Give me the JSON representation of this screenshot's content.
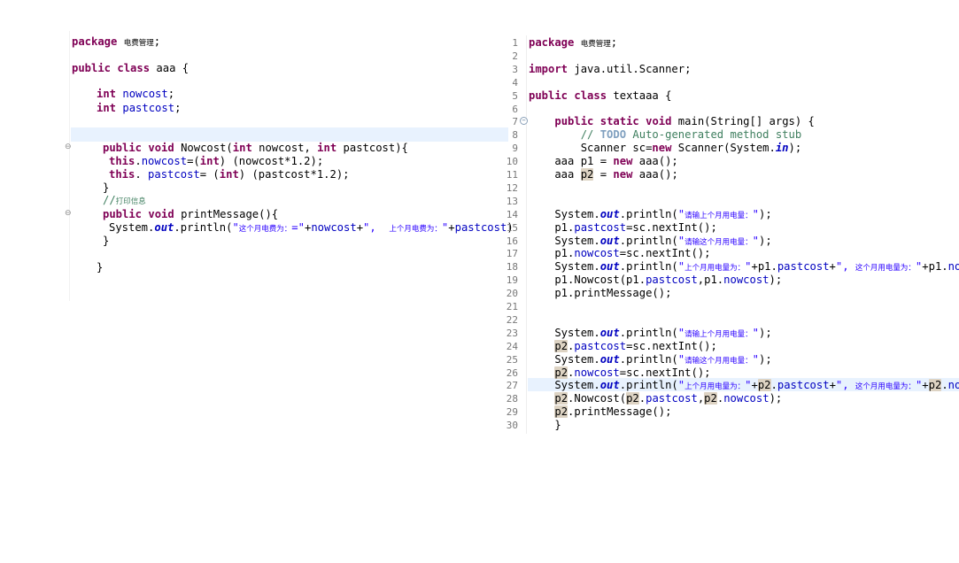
{
  "left_editor": {
    "lines": [
      {
        "parts": [
          {
            "t": "package",
            "c": "kw"
          },
          {
            "t": " "
          },
          {
            "t": "电费管理",
            "c": "cjk"
          },
          {
            "t": ";"
          }
        ]
      },
      {
        "parts": [
          {
            "t": "public",
            "c": "kw"
          },
          {
            "t": " "
          },
          {
            "t": "class",
            "c": "kw"
          },
          {
            "t": " aaa {"
          }
        ]
      },
      {
        "parts": [
          {
            "t": "int",
            "c": "kw"
          },
          {
            "t": " "
          },
          {
            "t": "nowcost",
            "c": "fld"
          },
          {
            "t": ";"
          }
        ]
      },
      {
        "parts": [
          {
            "t": "int",
            "c": "kw"
          },
          {
            "t": " "
          },
          {
            "t": "pastcost",
            "c": "fld"
          },
          {
            "t": ";"
          }
        ]
      },
      {
        "parts": [
          {
            "t": "public",
            "c": "kw"
          },
          {
            "t": " "
          },
          {
            "t": "void",
            "c": "kw"
          },
          {
            "t": " Nowcost("
          },
          {
            "t": "int",
            "c": "kw"
          },
          {
            "t": " nowcost, "
          },
          {
            "t": "int",
            "c": "kw"
          },
          {
            "t": " pastcost){"
          }
        ]
      },
      {
        "parts": [
          {
            "t": "this",
            "c": "kw"
          },
          {
            "t": "."
          },
          {
            "t": "nowcost",
            "c": "fld"
          },
          {
            "t": "=("
          },
          {
            "t": "int",
            "c": "kw"
          },
          {
            "t": ") (nowcost*1.2);"
          }
        ]
      },
      {
        "parts": [
          {
            "t": "this",
            "c": "kw"
          },
          {
            "t": ". "
          },
          {
            "t": "pastcost",
            "c": "fld"
          },
          {
            "t": "= ("
          },
          {
            "t": "int",
            "c": "kw"
          },
          {
            "t": ") (pastcost*1.2);"
          }
        ]
      },
      {
        "parts": [
          {
            "t": "}"
          }
        ]
      },
      {
        "parts": [
          {
            "t": "//",
            "c": "cmt"
          },
          {
            "t": "打印信息",
            "c": "cmt cjk"
          }
        ]
      },
      {
        "parts": [
          {
            "t": "public",
            "c": "kw"
          },
          {
            "t": " "
          },
          {
            "t": "void",
            "c": "kw"
          },
          {
            "t": " printMessage(){"
          }
        ]
      },
      {
        "parts": [
          {
            "t": "System."
          },
          {
            "t": "out",
            "c": "sfld"
          },
          {
            "t": ".println("
          },
          {
            "t": "\"",
            "c": "str"
          },
          {
            "t": "这个月电费为：",
            "c": "str cjk"
          },
          {
            "t": "=\"",
            "c": "str"
          },
          {
            "t": "+"
          },
          {
            "t": "nowcost",
            "c": "fld"
          },
          {
            "t": "+"
          },
          {
            "t": "\",  ",
            "c": "str"
          },
          {
            "t": "上个月电费为：",
            "c": "str cjk"
          },
          {
            "t": "\"",
            "c": "str"
          },
          {
            "t": "+"
          },
          {
            "t": "pastcost",
            "c": "fld"
          },
          {
            "t": ")"
          }
        ]
      },
      {
        "parts": [
          {
            "t": "}"
          }
        ]
      },
      {
        "parts": [
          {
            "t": "}"
          }
        ]
      }
    ]
  },
  "right_editor": {
    "line_numbers": [
      "1",
      "2",
      "3",
      "4",
      "5",
      "6",
      "7",
      "8",
      "9",
      "10",
      "11",
      "12",
      "13",
      "14",
      "15",
      "16",
      "17",
      "18",
      "19",
      "20",
      "21",
      "22",
      "23",
      "24",
      "25",
      "26",
      "27",
      "28",
      "29",
      "30"
    ],
    "lines": [
      {
        "parts": [
          {
            "t": "package",
            "c": "kw"
          },
          {
            "t": " "
          },
          {
            "t": "电费管理",
            "c": "cjk"
          },
          {
            "t": ";"
          }
        ]
      },
      {
        "parts": []
      },
      {
        "parts": [
          {
            "t": "import",
            "c": "kw"
          },
          {
            "t": " java.util.Scanner;"
          }
        ]
      },
      {
        "parts": []
      },
      {
        "parts": [
          {
            "t": "public",
            "c": "kw"
          },
          {
            "t": " "
          },
          {
            "t": "class",
            "c": "kw"
          },
          {
            "t": " textaaa {"
          }
        ]
      },
      {
        "parts": []
      },
      {
        "parts": [
          {
            "t": "    "
          },
          {
            "t": "public",
            "c": "kw"
          },
          {
            "t": " "
          },
          {
            "t": "static",
            "c": "kw"
          },
          {
            "t": " "
          },
          {
            "t": "void",
            "c": "kw"
          },
          {
            "t": " main(String[] args) {"
          }
        ]
      },
      {
        "parts": [
          {
            "t": "        "
          },
          {
            "t": "// ",
            "c": "cmt"
          },
          {
            "t": "TODO",
            "c": "tag"
          },
          {
            "t": " Auto-generated method stub",
            "c": "cmt"
          }
        ]
      },
      {
        "parts": [
          {
            "t": "        Scanner sc="
          },
          {
            "t": "new",
            "c": "kw"
          },
          {
            "t": " Scanner(System."
          },
          {
            "t": "in",
            "c": "sfld"
          },
          {
            "t": ");"
          }
        ]
      },
      {
        "parts": [
          {
            "t": "    aaa p1 = "
          },
          {
            "t": "new",
            "c": "kw"
          },
          {
            "t": " aaa();"
          }
        ]
      },
      {
        "parts": [
          {
            "t": "    aaa "
          },
          {
            "t": "p2",
            "c": "hl"
          },
          {
            "t": " = "
          },
          {
            "t": "new",
            "c": "kw"
          },
          {
            "t": " aaa();"
          }
        ]
      },
      {
        "parts": []
      },
      {
        "parts": []
      },
      {
        "parts": [
          {
            "t": "    System."
          },
          {
            "t": "out",
            "c": "sfld"
          },
          {
            "t": ".println("
          },
          {
            "t": "\"",
            "c": "str"
          },
          {
            "t": "请输上个月用电量：",
            "c": "str cjk"
          },
          {
            "t": "\"",
            "c": "str"
          },
          {
            "t": ");"
          }
        ]
      },
      {
        "parts": [
          {
            "t": "    p1."
          },
          {
            "t": "pastcost",
            "c": "fld"
          },
          {
            "t": "=sc.nextInt();"
          }
        ]
      },
      {
        "parts": [
          {
            "t": "    System."
          },
          {
            "t": "out",
            "c": "sfld"
          },
          {
            "t": ".println("
          },
          {
            "t": "\"",
            "c": "str"
          },
          {
            "t": "请输这个月用电量：",
            "c": "str cjk"
          },
          {
            "t": "\"",
            "c": "str"
          },
          {
            "t": ");"
          }
        ]
      },
      {
        "parts": [
          {
            "t": "    p1."
          },
          {
            "t": "nowcost",
            "c": "fld"
          },
          {
            "t": "=sc.nextInt();"
          }
        ]
      },
      {
        "parts": [
          {
            "t": "    System."
          },
          {
            "t": "out",
            "c": "sfld"
          },
          {
            "t": ".println("
          },
          {
            "t": "\"",
            "c": "str"
          },
          {
            "t": "上个月用电量为：",
            "c": "str cjk"
          },
          {
            "t": "\"",
            "c": "str"
          },
          {
            "t": "+p1."
          },
          {
            "t": "pastcost",
            "c": "fld"
          },
          {
            "t": "+"
          },
          {
            "t": "\", ",
            "c": "str"
          },
          {
            "t": "这个月用电量为：",
            "c": "str cjk"
          },
          {
            "t": "\"",
            "c": "str"
          },
          {
            "t": "+p1."
          },
          {
            "t": "nowcost",
            "c": "fld"
          },
          {
            "t": ");"
          }
        ]
      },
      {
        "parts": [
          {
            "t": "    p1.Nowcost(p1."
          },
          {
            "t": "pastcost",
            "c": "fld"
          },
          {
            "t": ",p1."
          },
          {
            "t": "nowcost",
            "c": "fld"
          },
          {
            "t": ");"
          }
        ]
      },
      {
        "parts": [
          {
            "t": "    p1.printMessage();"
          }
        ]
      },
      {
        "parts": []
      },
      {
        "parts": []
      },
      {
        "parts": [
          {
            "t": "    System."
          },
          {
            "t": "out",
            "c": "sfld"
          },
          {
            "t": ".println("
          },
          {
            "t": "\"",
            "c": "str"
          },
          {
            "t": "请输上个月用电量：",
            "c": "str cjk"
          },
          {
            "t": "\"",
            "c": "str"
          },
          {
            "t": ");"
          }
        ]
      },
      {
        "parts": [
          {
            "t": "    "
          },
          {
            "t": "p2",
            "c": "hl"
          },
          {
            "t": "."
          },
          {
            "t": "pastcost",
            "c": "fld"
          },
          {
            "t": "=sc.nextInt();"
          }
        ]
      },
      {
        "parts": [
          {
            "t": "    System."
          },
          {
            "t": "out",
            "c": "sfld"
          },
          {
            "t": ".println("
          },
          {
            "t": "\"",
            "c": "str"
          },
          {
            "t": "请输这个月用电量：",
            "c": "str cjk"
          },
          {
            "t": "\"",
            "c": "str"
          },
          {
            "t": ");"
          }
        ]
      },
      {
        "parts": [
          {
            "t": "    "
          },
          {
            "t": "p2",
            "c": "hl"
          },
          {
            "t": "."
          },
          {
            "t": "nowcost",
            "c": "fld"
          },
          {
            "t": "=sc.nextInt();"
          }
        ]
      },
      {
        "parts": [
          {
            "t": "    System."
          },
          {
            "t": "out",
            "c": "sfld"
          },
          {
            "t": ".println("
          },
          {
            "t": "\"",
            "c": "str"
          },
          {
            "t": "上个月用电量为：",
            "c": "str cjk"
          },
          {
            "t": "\"",
            "c": "str"
          },
          {
            "t": "+"
          },
          {
            "t": "p2",
            "c": "hl"
          },
          {
            "t": "."
          },
          {
            "t": "pastcost",
            "c": "fld"
          },
          {
            "t": "+"
          },
          {
            "t": "\", ",
            "c": "str"
          },
          {
            "t": "这个月用电量为：",
            "c": "str cjk"
          },
          {
            "t": "\"",
            "c": "str"
          },
          {
            "t": "+"
          },
          {
            "t": "p2",
            "c": "hl"
          },
          {
            "t": "."
          },
          {
            "t": "nowcost",
            "c": "fld"
          },
          {
            "t": ");"
          }
        ]
      },
      {
        "parts": [
          {
            "t": "    "
          },
          {
            "t": "p2",
            "c": "hl"
          },
          {
            "t": ".Nowcost("
          },
          {
            "t": "p2",
            "c": "hl"
          },
          {
            "t": "."
          },
          {
            "t": "pastcost",
            "c": "fld"
          },
          {
            "t": ","
          },
          {
            "t": "p2",
            "c": "hl"
          },
          {
            "t": "."
          },
          {
            "t": "nowcost",
            "c": "fld"
          },
          {
            "t": ");"
          }
        ]
      },
      {
        "parts": [
          {
            "t": "    "
          },
          {
            "t": "p2",
            "c": "hl"
          },
          {
            "t": ".printMessage();"
          }
        ]
      },
      {
        "parts": [
          {
            "t": "    }"
          }
        ]
      }
    ]
  }
}
